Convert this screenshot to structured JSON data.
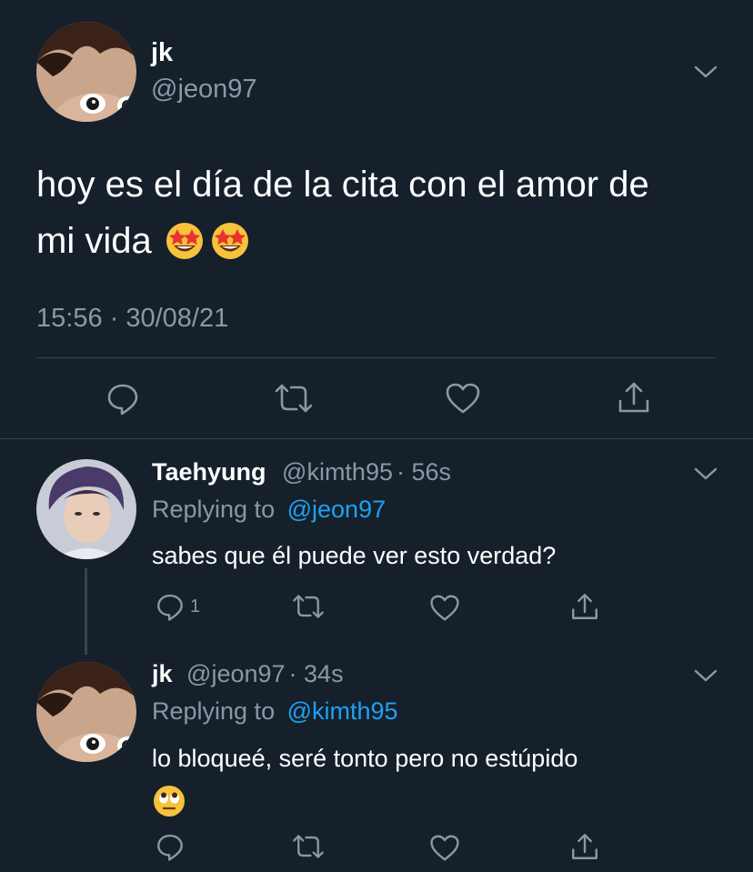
{
  "main_tweet": {
    "display_name": "jk",
    "handle": "@jeon97",
    "text": "hoy es el día de la cita con el amor de mi vida 🤩🤩",
    "text_line1": "hoy es el día de la cita con el amor de",
    "text_line2": "mi vida",
    "timestamp": "15:56 · 30/08/21"
  },
  "replies": [
    {
      "display_name": "Taehyung",
      "handle": "@kimth95",
      "age": "· 56s",
      "replying_prefix": "Replying to",
      "replying_to": "@jeon97",
      "text": "sabes que él puede ver esto verdad?",
      "reply_count": "1"
    },
    {
      "display_name": "jk",
      "handle": "@jeon97",
      "age": "· 34s",
      "replying_prefix": "Replying to",
      "replying_to": "@kimth95",
      "text": "lo bloqueé, seré tonto pero no estúpido"
    }
  ],
  "icons": {
    "reply": "reply-icon",
    "retweet": "retweet-icon",
    "like": "heart-icon",
    "share": "share-icon",
    "menu": "chevron-down-icon"
  },
  "colors": {
    "background": "#15202b",
    "muted": "#8899a6",
    "link": "#1da1f2",
    "divider": "#38444d"
  }
}
